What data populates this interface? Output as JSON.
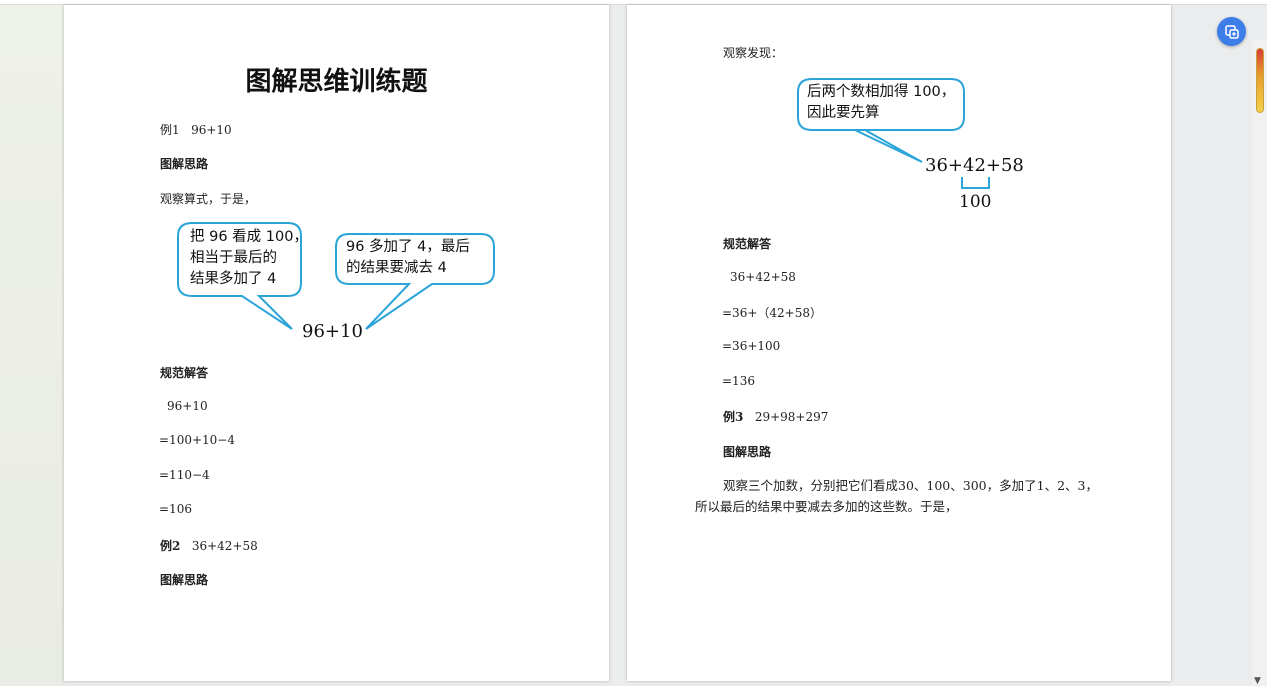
{
  "page1": {
    "title": "图解思维训练题",
    "ex1_label": "例1",
    "ex1_expr": "96+10",
    "h_thinking": "图解思路",
    "observe": "观察算式，于是，",
    "bubble1": [
      "把 96 看成 100，",
      "相当于最后的",
      "结果多加了 4"
    ],
    "bubble2": [
      "96 多加了 4，最后",
      "的结果要减去 4"
    ],
    "figure_expr": "96+10",
    "h_answer": "规范解答",
    "steps": [
      "96+10",
      "=100+10−4",
      "=110−4",
      "=106"
    ],
    "ex2_label": "例2",
    "ex2_expr": "36+42+58",
    "h_thinking2": "图解思路"
  },
  "page2": {
    "observe": "观察发现：",
    "bubble": [
      "后两个数相加得 100，",
      "因此要先算"
    ],
    "figure_expr": "36+42+58",
    "figure_sum": "100",
    "h_answer": "规范解答",
    "steps": [
      "36+42+58",
      "=36+（42+58）",
      "=36+100",
      "=136"
    ],
    "ex3_label": "例3",
    "ex3_expr": "29+98+297",
    "h_thinking": "图解思路",
    "para": "观察三个加数，分别把它们看成30、100、300，多加了1、2、3，所以最后的结果中要减去多加的这些数。于是，"
  },
  "ui": {
    "fab_icon": "translate-icon",
    "accent": "#3c7de8",
    "bubble_stroke": "#2ba4d8"
  }
}
